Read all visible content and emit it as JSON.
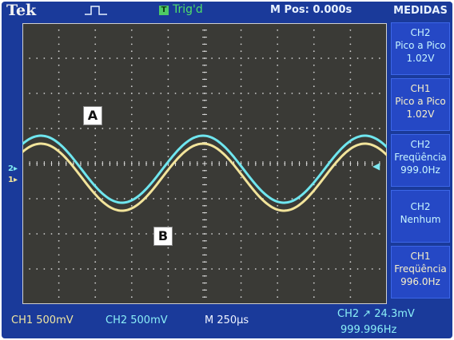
{
  "header": {
    "brand": "Tek",
    "trigger_badge": "T",
    "trigger_status": "Trig'd",
    "main_position": "M Pos: 0.000s"
  },
  "annotations": {
    "marker_a": "A",
    "marker_b": "B"
  },
  "channel_markers": {
    "ch2": "2",
    "ch1": "1"
  },
  "measure_panel": {
    "title": "MEDIDAS",
    "items": [
      {
        "lines": [
          "CH2",
          "Pico a Pico",
          "1.02V"
        ]
      },
      {
        "lines": [
          "CH1",
          "Pico a Pico",
          "1.02V"
        ]
      },
      {
        "lines": [
          "CH2",
          "Freqüência",
          "999.0Hz"
        ]
      },
      {
        "lines": [
          "CH2",
          "Nenhum"
        ]
      },
      {
        "lines": [
          "CH1",
          "Freqüência",
          "996.0Hz"
        ]
      }
    ]
  },
  "status": {
    "ch1": "CH1  500mV",
    "ch2": "CH2  500mV",
    "timebase": "M 250µs",
    "trigger": "CH2 ↗ 24.3mV",
    "trigger_freq": "999.996Hz"
  },
  "waveforms": {
    "ch1_color": "#f2e49b",
    "ch2_color": "#6fe6ef",
    "periods_visible": 2.25
  },
  "colors": {
    "screen_bg": "#1a3a9a",
    "panel_box": "#2548c5",
    "trig_green": "#4fe06a"
  }
}
